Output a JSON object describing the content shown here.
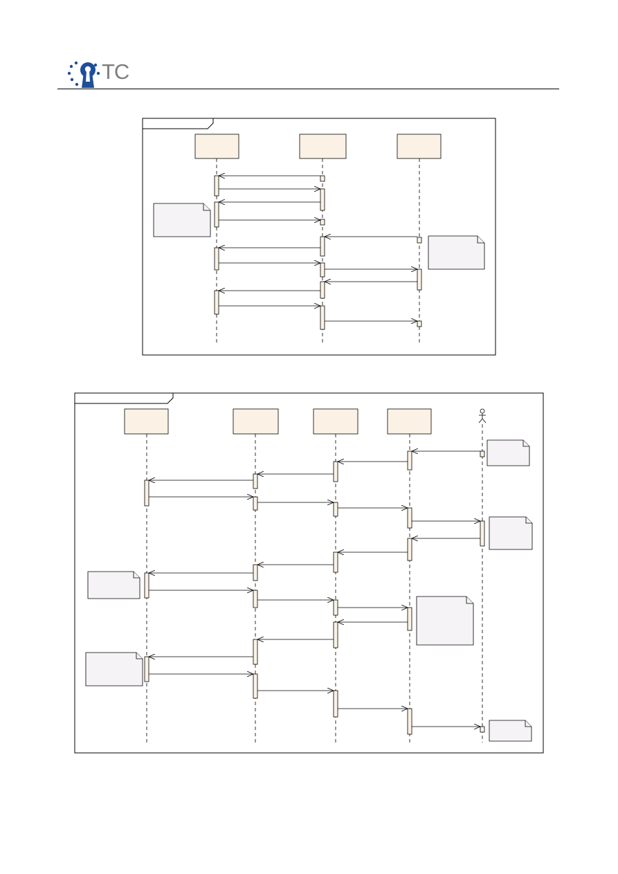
{
  "header": {
    "logo_text": "TC"
  },
  "colors": {
    "lifeline_box_fill": "#fbf2e5",
    "note_fill": "#f6f3f7",
    "logo_blue": "#1f4e9a",
    "logo_text_gray": "#7e7e7e"
  },
  "icons": {
    "logo": "keyhole-logo-icon",
    "actor": "stick-figure-icon",
    "note": "note-corner-fold-icon"
  }
}
